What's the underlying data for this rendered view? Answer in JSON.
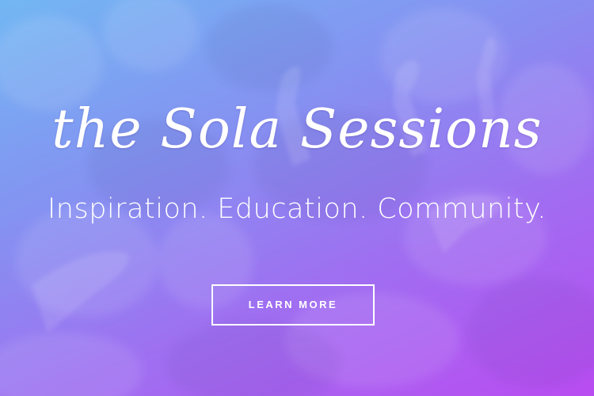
{
  "hero": {
    "title": "the Sola Sessions",
    "subtitle": "Inspiration. Education. Community.",
    "cta_label": "LEARN MORE"
  },
  "colors": {
    "gradient_top_left": "#6fb4f2",
    "gradient_mid": "#8f7df0",
    "gradient_bottom_right": "#b54cf0",
    "text": "#ffffff"
  }
}
